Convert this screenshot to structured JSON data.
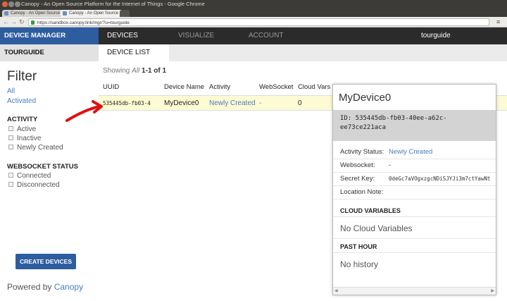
{
  "window": {
    "title": "Canopy - An Open Source Platform for the Internet of Things - Google Chrome"
  },
  "browser": {
    "tabs": [
      {
        "label": "Canopy - An Open Source"
      },
      {
        "label": "Canopy - An Open Source"
      }
    ],
    "url": "https://sandbox.canopy.link/mgr/?u=tourguide"
  },
  "header": {
    "brand": "DEVICE MANAGER",
    "nav": [
      "DEVICES",
      "VISUALIZE",
      "ACCOUNT"
    ],
    "username": "tourguide"
  },
  "subnav": {
    "left": "TOURGUIDE",
    "tab": "DEVICE LIST"
  },
  "sidebar": {
    "title": "Filter",
    "links": [
      "All",
      "Activated"
    ],
    "activity_heading": "ACTIVITY",
    "activity_options": [
      "Active",
      "Inactive",
      "Newly Created"
    ],
    "websocket_heading": "WEBSOCKET STATUS",
    "websocket_options": [
      "Connected",
      "Disconnected"
    ],
    "create_button": "CREATE DEVICES",
    "powered_by": "Powered by",
    "powered_brand": "Canopy"
  },
  "table": {
    "showing_prefix": "Showing",
    "showing_filter": "All",
    "showing_range": "1-1 of 1",
    "columns": [
      "UUID",
      "Device Name",
      "Activity",
      "WebSocket",
      "Cloud Vars"
    ],
    "rows": [
      {
        "uuid": "535445db-fb03-4",
        "name": "MyDevice0",
        "activity": "Newly Created",
        "websocket": "-",
        "cloud_vars": "0"
      }
    ]
  },
  "panel": {
    "title": "MyDevice0",
    "id_line1": "ID: 535445db-fb03-40ee-a62c-",
    "id_line2": "ee73ce221aca",
    "activity_label": "Activity Status:",
    "activity_value": "Newly Created",
    "websocket_label": "Websocket:",
    "websocket_value": "-",
    "secret_label": "Secret Key:",
    "secret_value": "0deGc7aVOgxzgcNDiSJYJi3m7ctYawNt",
    "location_label": "Location Note:",
    "cloud_heading": "CLOUD VARIABLES",
    "cloud_empty": "No Cloud Variables",
    "past_heading": "PAST HOUR",
    "past_empty": "No history"
  },
  "colors": {
    "brand_blue": "#2d5d9f",
    "link_blue": "#4a7cc0",
    "highlight_row": "#fdfbd3",
    "annotation_red": "#e01010"
  }
}
